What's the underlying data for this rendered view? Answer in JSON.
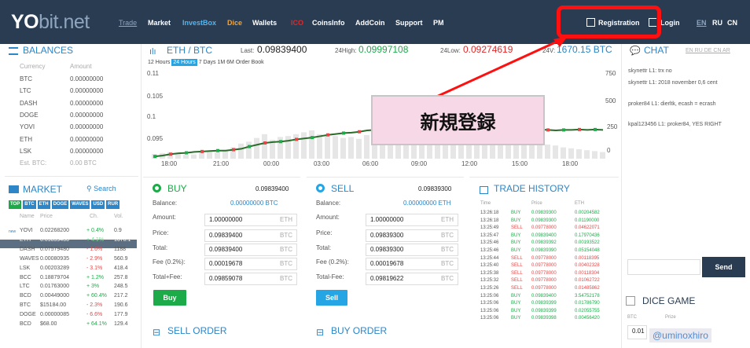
{
  "topbar": {
    "logo_main": "YO",
    "logo_bit": "bit",
    "logo_net": ".net",
    "trade": "Trade",
    "nav": [
      "Market",
      "InvestBox",
      "Dice",
      "Wallets",
      "ICO",
      "CoinsInfo",
      "AddCoin",
      "Support",
      "PM"
    ],
    "registration": "Registration",
    "login": "Login",
    "langs": [
      "EN",
      "RU",
      "CN"
    ]
  },
  "balances": {
    "title": "BALANCES",
    "head": [
      "Currency",
      "Amount"
    ],
    "rows": [
      [
        "BTC",
        "0.00000000"
      ],
      [
        "LTC",
        "0.00000000"
      ],
      [
        "DASH",
        "0.00000000"
      ],
      [
        "DOGE",
        "0.00000000"
      ],
      [
        "YOVI",
        "0.00000000"
      ],
      [
        "ETH",
        "0.00000000"
      ],
      [
        "LSK",
        "0.00000000"
      ]
    ],
    "est": "Est. BTC:",
    "est_val": "0.00 BTC"
  },
  "market": {
    "title": "MARKET",
    "search": "Search",
    "tabs": [
      "TOP",
      "BTC",
      "ETH",
      "DOGE",
      "WAVES",
      "USD",
      "RUR"
    ],
    "head": [
      "Name",
      "Price",
      "Ch.",
      "Vol."
    ],
    "rows": [
      [
        "YOVI",
        "0.02268200",
        "+ 0.4%",
        "0.9"
      ],
      [
        "ETH",
        "0.09839400",
        "+ 4.1%",
        "1670.1"
      ],
      [
        "DASH",
        "0.07579480",
        "- 1.6%",
        "1188"
      ],
      [
        "WAVES",
        "0.00080935",
        "- 2.9%",
        "560.9"
      ],
      [
        "LSK",
        "0.00203289",
        "- 3.1%",
        "418.4"
      ],
      [
        "BCC",
        "0.18879704",
        "+ 1.2%",
        "257.8"
      ],
      [
        "LTC",
        "0.01763000",
        "+ 3%",
        "248.5"
      ],
      [
        "BCD",
        "0.00449000",
        "+ 60.4%",
        "217.2"
      ],
      [
        "BTC",
        "$15184.00",
        "- 2.3%",
        "190.6"
      ],
      [
        "DOGE",
        "0.00000085",
        "- 6.6%",
        "177.9"
      ],
      [
        "BCD",
        "$68.00",
        "+ 64.1%",
        "129.4"
      ]
    ],
    "prefix": "new"
  },
  "pair": {
    "title": "ETH / BTC",
    "last_label": "Last:",
    "last": "0.09839400",
    "high_label": "24High:",
    "high": "0.09997108",
    "low_label": "24Low:",
    "low": "0.09274619",
    "vol_label": "24V:",
    "vol": "1670.15 BTC"
  },
  "chart_tabs": [
    "12 Hours",
    "24 Hours",
    "7 Days",
    "1M",
    "6M",
    "Order Book"
  ],
  "chart_data": {
    "type": "line",
    "x": [
      "18:00",
      "21:00",
      "00:00",
      "03:00",
      "06:00",
      "09:00",
      "12:00",
      "15:00",
      "18:00"
    ],
    "y_left": [
      "0.11",
      "0.105",
      "0.1",
      "0.095"
    ],
    "y_right": [
      "750",
      "500",
      "250",
      "0"
    ],
    "price": [
      0.093,
      0.0932,
      0.0935,
      0.0937,
      0.0938,
      0.094,
      0.0941,
      0.0942,
      0.0943,
      0.0943,
      0.0945,
      0.0947,
      0.0952,
      0.0956,
      0.096,
      0.0962,
      0.0963,
      0.0965,
      0.0968,
      0.097,
      0.0972,
      0.0975,
      0.0978,
      0.098,
      0.0982,
      0.0983,
      0.0985,
      0.0988,
      0.0989,
      0.099,
      0.0992,
      0.0994,
      0.0994,
      0.0993,
      0.0993,
      0.0994,
      0.0995,
      0.0993,
      0.0992,
      0.0993,
      0.0994,
      0.0993,
      0.0991,
      0.099,
      0.099,
      0.0991,
      0.099,
      0.099,
      0.0991,
      0.099,
      0.0989,
      0.0988,
      0.0989,
      0.0989,
      0.099,
      0.0989,
      0.099,
      0.0989
    ],
    "volume": [
      50,
      60,
      70,
      55,
      40,
      45,
      65,
      80,
      70,
      90,
      120,
      160,
      180,
      220,
      260,
      200,
      230,
      240,
      260,
      280,
      300,
      260,
      250,
      240,
      220,
      230,
      210,
      250,
      260,
      230,
      200,
      210,
      180,
      170,
      190,
      200,
      210,
      220,
      230,
      240,
      220,
      210,
      190,
      180,
      170,
      190,
      200,
      180,
      170,
      160,
      150,
      140,
      120,
      110,
      100,
      90,
      80,
      70
    ]
  },
  "buy": {
    "title": "BUY",
    "price": "0.09839400",
    "balance_label": "Balance:",
    "balance": "0.00000000 BTC",
    "amount_label": "Amount:",
    "amount": "1.00000000",
    "amount_unit": "ETH",
    "price_label": "Price:",
    "price_val": "0.09839400",
    "price_unit": "BTC",
    "total_label": "Total:",
    "total": "0.09839400",
    "total_unit": "BTC",
    "fee_label": "Fee (0.2%):",
    "fee": "0.00019678",
    "fee_unit": "BTC",
    "totalfee_label": "Total+Fee:",
    "totalfee": "0.09859078",
    "totalfee_unit": "BTC",
    "button": "Buy"
  },
  "sell": {
    "title": "SELL",
    "price": "0.09839300",
    "balance_label": "Balance:",
    "balance": "0.00000000 ETH",
    "amount_label": "Amount:",
    "amount": "1.00000000",
    "amount_unit": "ETH",
    "price_label": "Price:",
    "price_val": "0.09839300",
    "price_unit": "BTC",
    "total_label": "Total:",
    "total": "0.09839300",
    "total_unit": "BTC",
    "fee_label": "Fee (0.2%):",
    "fee": "0.00019678",
    "fee_unit": "BTC",
    "totalfee_label": "Total-Fee:",
    "totalfee": "0.09819622",
    "totalfee_unit": "BTC",
    "button": "Sell"
  },
  "sell_order": "SELL ORDER",
  "buy_order": "BUY ORDER",
  "trade_history": {
    "title": "TRADE HISTORY",
    "head": [
      "Time",
      "",
      "Price",
      "ETH"
    ],
    "rows": [
      [
        "13:26:18",
        "BUY",
        "0.09839300",
        "0.00204582"
      ],
      [
        "13:26:18",
        "BUY",
        "0.09839300",
        "0.01190000"
      ],
      [
        "13:25:49",
        "SELL",
        "0.09778000",
        "0.04622071"
      ],
      [
        "13:25:47",
        "BUY",
        "0.09839400",
        "0.17970436"
      ],
      [
        "13:25:46",
        "BUY",
        "0.09839392",
        "0.00193522"
      ],
      [
        "13:25:46",
        "BUY",
        "0.09839390",
        "0.05154048"
      ],
      [
        "13:25:44",
        "SELL",
        "0.09778000",
        "0.00118395"
      ],
      [
        "13:25:40",
        "SELL",
        "0.09778000",
        "0.00402328"
      ],
      [
        "13:25:38",
        "SELL",
        "0.09778000",
        "0.00118304"
      ],
      [
        "13:25:32",
        "SELL",
        "0.09778000",
        "0.01062722"
      ],
      [
        "13:25:26",
        "SELL",
        "0.09778000",
        "0.01485862"
      ],
      [
        "13:25:06",
        "BUY",
        "0.09839400",
        "3.54752178"
      ],
      [
        "13:25:06",
        "BUY",
        "0.09839399",
        "0.01786790"
      ],
      [
        "13:25:06",
        "BUY",
        "0.09839399",
        "0.02055755"
      ],
      [
        "13:25:06",
        "BUY",
        "0.09839398",
        "0.00456420"
      ]
    ]
  },
  "chat": {
    "title": "CHAT",
    "langs": "EN RU DE CN AR",
    "messages": [
      "skynettr L1: trx no",
      "skynettr L1: 2018 november 0,6 cent",
      "proker84 L1: dierltk, ecash = ecrash",
      "kpal123456 L1: proker84, YES RIGHT"
    ],
    "send": "Send"
  },
  "dice": {
    "title": "DICE GAME",
    "head": [
      "BTC",
      "Prize"
    ],
    "val": "0.01"
  },
  "callout": "新規登録",
  "watermark": "@uminoxhiro",
  "colors": {
    "topbar": "#2a3c52",
    "accent": "#2c86c8",
    "buy": "#1dab4a",
    "sell": "#e24848",
    "callout_border": "#ff1010"
  }
}
